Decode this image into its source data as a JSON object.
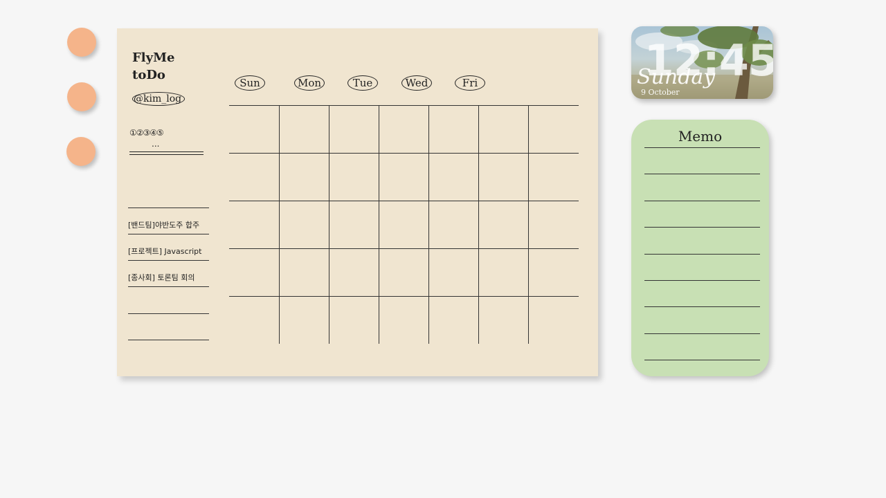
{
  "colors": {
    "background": "#f6f6f6",
    "dot": "#f5b48a",
    "planner": "#f0e5d0",
    "memo": "#c8e0b4"
  },
  "planner": {
    "title": "FlyMe toDo",
    "handle": "@kim_log",
    "steps": "①②③④⑤",
    "ellipsis": "...",
    "days": [
      "Sun",
      "Mon",
      "Tue",
      "Wed",
      "Fri"
    ],
    "todos": [
      "",
      "[밴드팀]야반도주 합주",
      "[프로젝트] Javascript",
      "[종사회] 토론팀 회의",
      "",
      ""
    ]
  },
  "clock": {
    "time": "12:45",
    "day": "Sunday",
    "date": "9 October"
  },
  "memo": {
    "title": "Memo"
  }
}
